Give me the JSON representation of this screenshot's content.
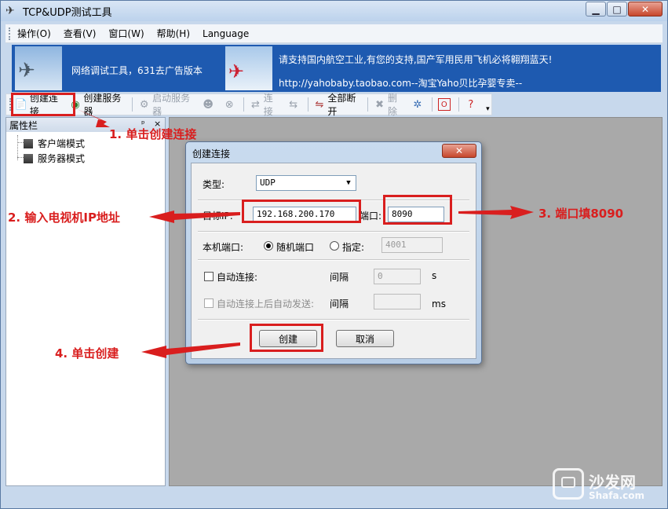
{
  "window": {
    "title": "TCP&UDP测试工具",
    "buttons": {
      "minimize": "▁",
      "maximize": "□",
      "close": "✕"
    }
  },
  "menu": [
    "操作(O)",
    "查看(V)",
    "窗口(W)",
    "帮助(H)",
    "Language"
  ],
  "banner": {
    "left_text": "网络调试工具，631去广告版本",
    "right_line1": "请支持国内航空工业,有您的支持,国产军用民用飞机必将翱翔蓝天!",
    "right_line2": "http://yahobaby.taobao.com--淘宝Yaho贝比孕婴专卖--"
  },
  "toolbar": {
    "create_conn": "创建连接",
    "create_server": "创建服务器",
    "start_server": "启动服务器",
    "connect": "连接",
    "disconnect_all": "全部断开",
    "delete": "删除"
  },
  "sidepanel": {
    "title": "属性栏",
    "pin": "ᵖ",
    "close": "×",
    "items": [
      "客户端模式",
      "服务器模式"
    ]
  },
  "dialog": {
    "title": "创建连接",
    "close": "✕",
    "type_label": "类型:",
    "type_value": "UDP",
    "target_ip_label": "目标IP:",
    "target_ip_value": "192.168.200.170",
    "port_label": "端口:",
    "port_value": "8090",
    "local_port_label": "本机端口:",
    "random_port": "随机端口",
    "specify_port": "指定:",
    "specify_value": "4001",
    "auto_connect": "自动连接:",
    "interval_label1": "间隔",
    "interval_value": "0",
    "interval_unit1": "s",
    "auto_send": "自动连接上后自动发送:",
    "interval_label2": "间隔",
    "interval_unit2": "ms",
    "create_btn": "创建",
    "cancel_btn": "取消"
  },
  "annotations": {
    "step1": "1. 单击创建连接",
    "step2": "2. 输入电视机IP地址",
    "step3": "3. 端口填8090",
    "step4": "4. 单击创建",
    "color": "#d91e1e"
  },
  "watermark": {
    "cn": "沙发网",
    "en": "Shafa.com"
  }
}
